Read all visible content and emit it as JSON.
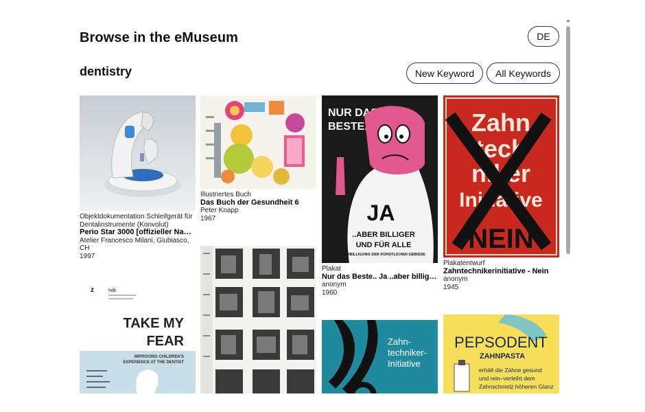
{
  "header": {
    "title": "Browse in the eMuseum",
    "language_button": "DE"
  },
  "keyword": {
    "label": "dentistry",
    "new_keyword_button": "New Keyword",
    "all_keywords_button": "All Keywords"
  },
  "items": [
    {
      "category": "Objektdokumentation Schleifgerät für Dentalinstrumente (Konvolut)",
      "title": "Perio Star 3000 [offizieller Name]",
      "maker": "Atelier Francesco Milani, Giubiasco, CH",
      "year": "1997"
    },
    {
      "category": "Illustriertes Buch",
      "title": "Das Buch der Gesundheit 6",
      "maker": "Peter Knapp",
      "year": "1967"
    },
    {
      "category": "Plakat",
      "title": "Nur das Beste.. Ja ..aber billige…",
      "maker": "anonym",
      "year": "1960",
      "poster_text": [
        "NUR DAS",
        "BESTE..",
        "JA",
        "..ABER BILLIGER",
        "UND FÜR ALLE",
        "VERBILLIGUNG DER KÜNSTLICHEN GEBISSE"
      ]
    },
    {
      "category": "Plakatentwurf",
      "title": "Zahntechnikerinitiative - Nein",
      "maker": "anonym",
      "year": "1945",
      "poster_text": [
        "Zahn",
        "tech",
        "niker",
        "Initiative",
        "NEIN"
      ]
    },
    {
      "poster_text": [
        "z",
        "hdk",
        "TAKE MY",
        "FEAR",
        "IMPROVING CHILDREN'S",
        "EXPERIENCE AT THE DENTIST"
      ]
    },
    {
      "poster_text": []
    },
    {
      "poster_text": [
        "Zahn-",
        "techniker-",
        "Initiative"
      ]
    },
    {
      "poster_text": [
        "PEPSODENT",
        "ZAHNPASTA",
        "erhält die Zähne gesund",
        "und rein–verleiht dem",
        "Zahnschmelz höheren Glanz"
      ]
    }
  ],
  "colors": {
    "poster_red": "#c8281e",
    "poster_pink": "#e0588d",
    "poster_teal": "#1f8a9e",
    "poster_yellow": "#f7df5a",
    "scrollbar": "#a9a9a9"
  }
}
